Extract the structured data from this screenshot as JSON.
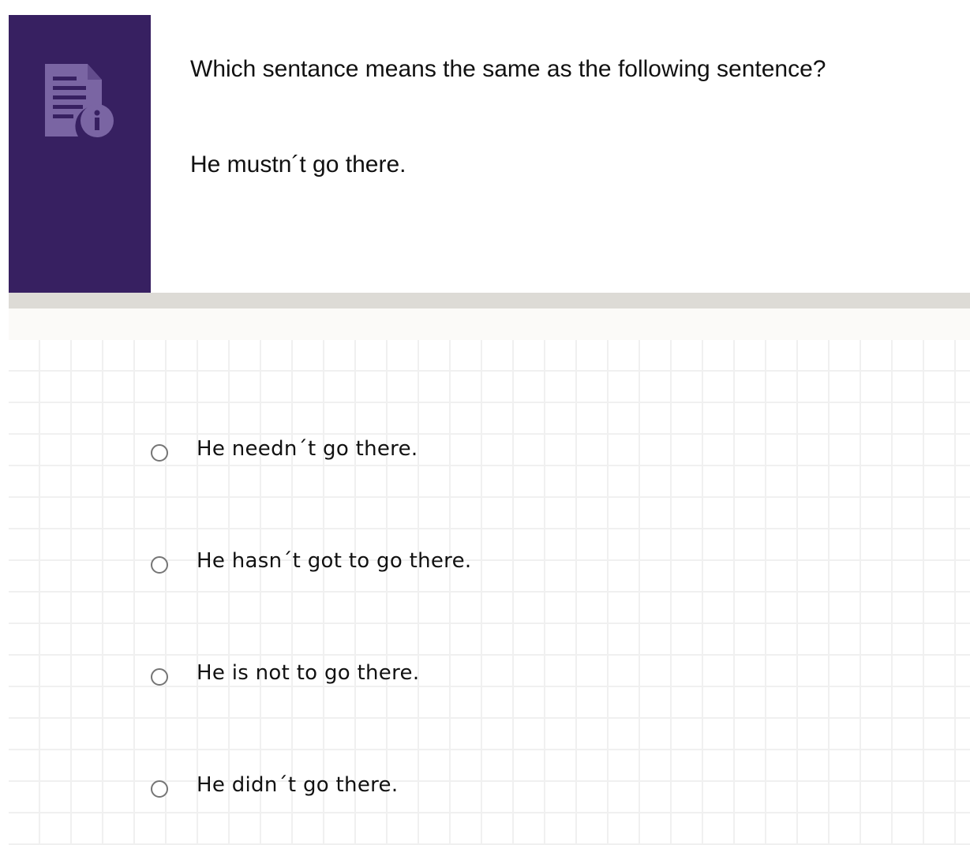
{
  "question": {
    "icon": "document-info-icon",
    "text": "Which sentance means the same as the following sentence?",
    "prompt": "He mustn´t go there."
  },
  "options": [
    {
      "label": "He needn´t go there.",
      "selected": false
    },
    {
      "label": "He hasn´t got to go there.",
      "selected": false
    },
    {
      "label": "He is not to go there.",
      "selected": false
    },
    {
      "label": "He didn´t go there.",
      "selected": false
    }
  ],
  "colors": {
    "icon_panel": "#372061",
    "icon_glyph": "#7a65a3",
    "divider": "#dddbd6",
    "radio_border": "#757575"
  }
}
